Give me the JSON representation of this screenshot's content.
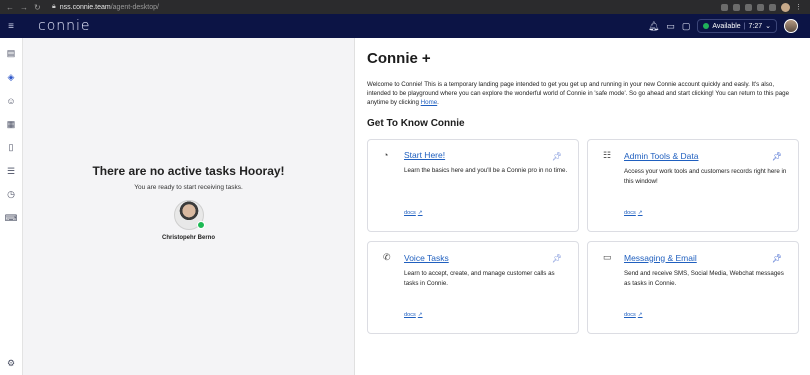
{
  "browser": {
    "url_host": "nss.connie.team",
    "url_path": "/agent-desktop/"
  },
  "topbar": {
    "logo": "connie",
    "status": "Available",
    "timer": "7:27"
  },
  "tasks_panel": {
    "heading": "There are no active tasks Hooray!",
    "subtext": "You are ready to start receiving tasks.",
    "agent_name": "Christopehr Berno"
  },
  "main": {
    "title": "Connie",
    "title_icon": "plus-icon",
    "intro_before": "Welcome to Connie! This is a temporary landing page intended to get you get up and running in your new Connie account quickly and easly. It's also, intended to be playground where you can explore the wonderful world of Connie in 'safe mode'. So go ahead and start clicking! You can return to this page anytime by clicking ",
    "intro_link": "Home",
    "intro_after": ".",
    "section_title": "Get To Know Connie",
    "cards": [
      {
        "title": "Start Here!",
        "icon": "dashboard-icon",
        "body": "Learn the basics here and you'll be a Connie pro in no time.",
        "link": "docs",
        "pinned": false
      },
      {
        "title": "Admin Tools & Data",
        "icon": "list-settings-icon",
        "body": "Access your work tools and customers records right here in this window!",
        "link": "docs",
        "pinned": true
      },
      {
        "title": "Voice Tasks",
        "icon": "phone-icon",
        "body": "Learn to accept, create, and manage customer calls as tasks in Connie.",
        "link": "docs",
        "pinned": false
      },
      {
        "title": "Messaging & Email",
        "icon": "chat-icon",
        "body": "Send and receive SMS, Social Media, Webchat messages as tasks in Connie.",
        "link": "docs",
        "pinned": true
      }
    ]
  }
}
